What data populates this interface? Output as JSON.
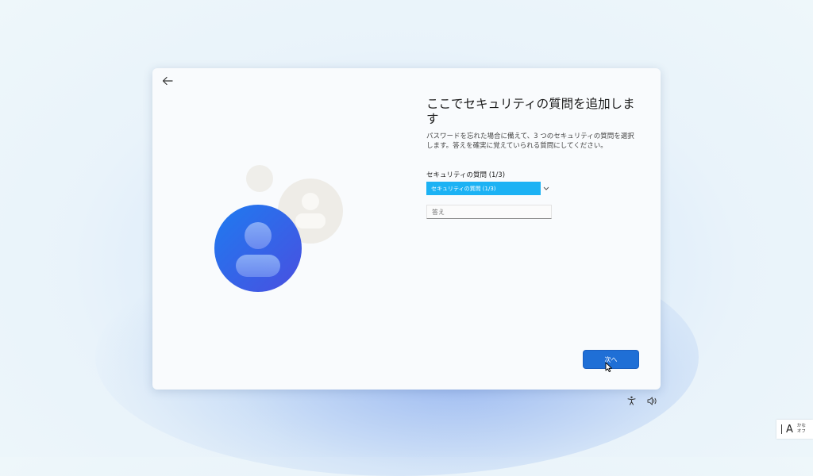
{
  "dialog": {
    "back_icon": "back-arrow-icon",
    "title": "ここでセキュリティの質問を追加します",
    "description": "パスワードを忘れた場合に備えて、3 つのセキュリティの質問を選択します。答えを確実に覚えていられる質問にしてください。",
    "question_label": "セキュリティの質問 (1/3)",
    "question_select_value": "セキュリティの質問 (1/3)",
    "answer_placeholder": "答え",
    "answer_value": "",
    "next_label": "次へ"
  },
  "taskbar": {
    "accessibility_icon": "accessibility-icon",
    "volume_icon": "volume-icon"
  },
  "ime": {
    "mode": "A",
    "line1": "かな",
    "line2": "オフ"
  },
  "colors": {
    "primary_button": "#1f6fd6",
    "select_highlight": "#1cb2f4",
    "avatar_gradient_start": "#1e7bf0",
    "avatar_gradient_end": "#4a4fe0"
  }
}
